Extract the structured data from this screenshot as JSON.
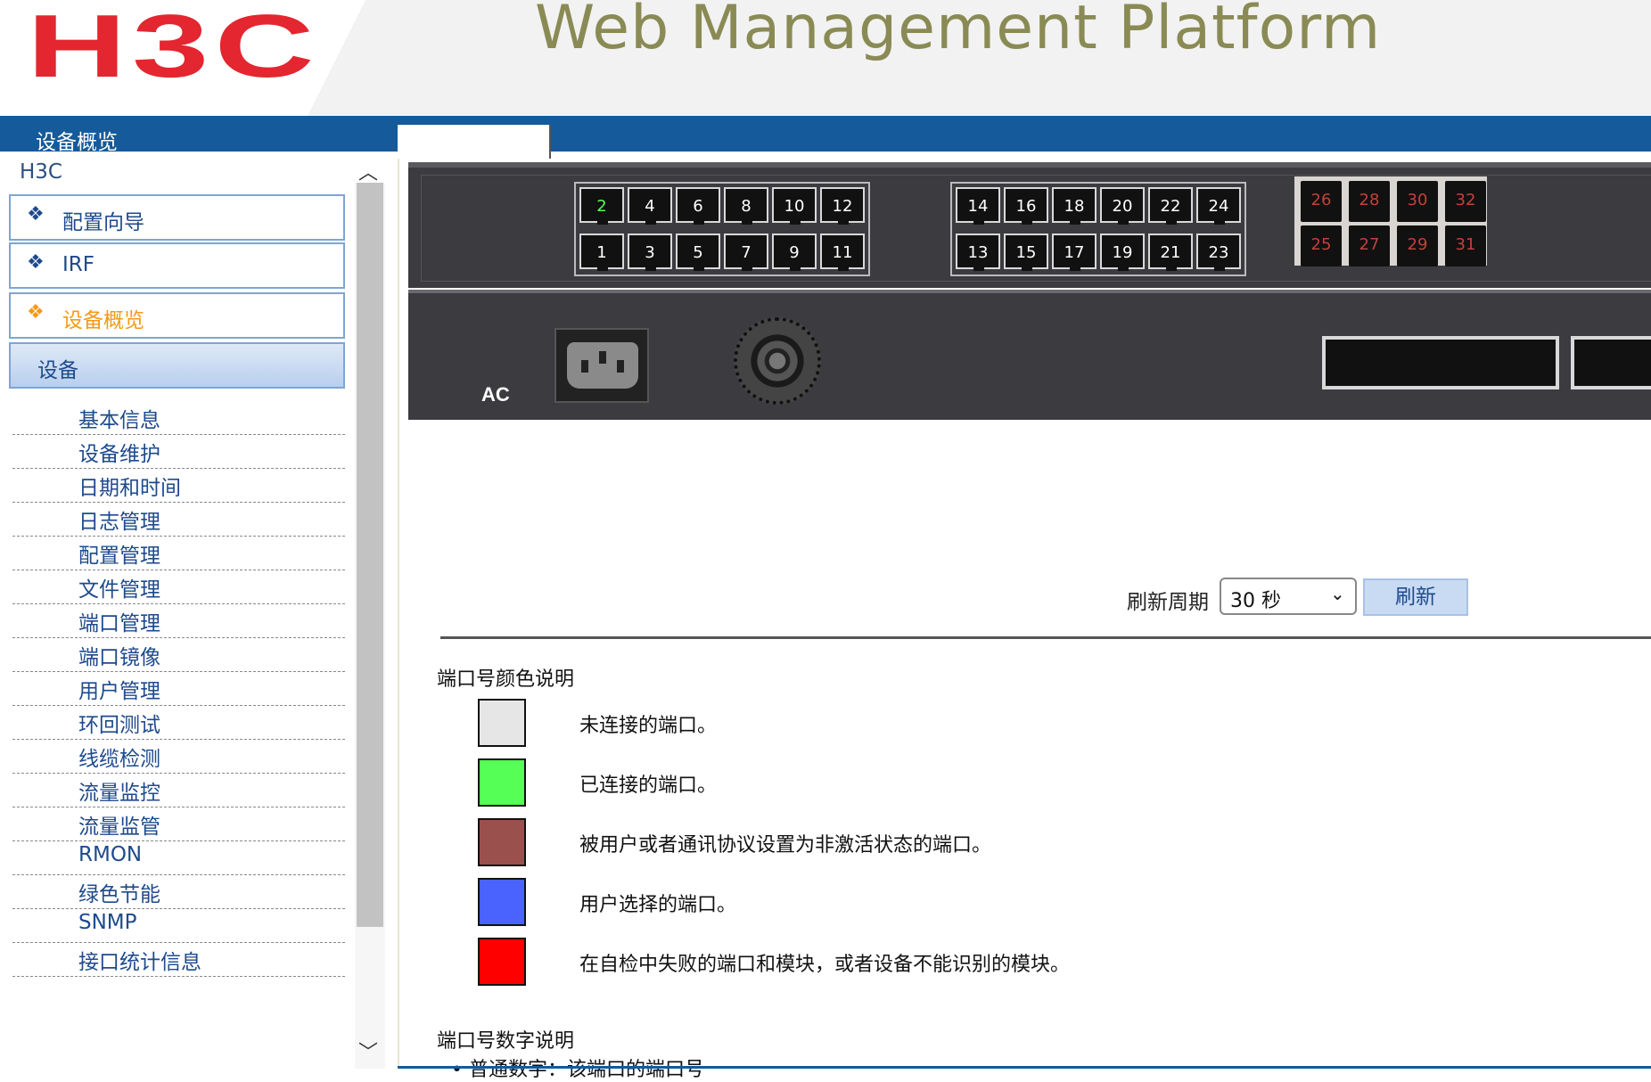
{
  "header": {
    "logo": "H3C",
    "title": "Web Management Platform",
    "breadcrumb": "设备概览"
  },
  "colors": {
    "brand_red": "#e3262f",
    "header_blue": "#155a9a",
    "menu_blue": "#1e4a8c",
    "active_orange": "#f49a16"
  },
  "sidebar": {
    "root": "H3C",
    "menus": [
      {
        "label": "配置向导",
        "icon": "diamond-icon"
      },
      {
        "label": "IRF",
        "icon": "diamond-icon"
      },
      {
        "label": "设备概览",
        "icon": "diamond-icon",
        "active": true
      }
    ],
    "group": "设备",
    "items": [
      "基本信息",
      "设备维护",
      "日期和时间",
      "日志管理",
      "配置管理",
      "文件管理",
      "端口管理",
      "端口镜像",
      "用户管理",
      "环回测试",
      "线缆检测",
      "流量监控",
      "流量监管",
      "RMON",
      "绿色节能",
      "SNMP",
      "接口统计信息"
    ]
  },
  "device": {
    "bank1_top": [
      "2",
      "4",
      "6",
      "8",
      "10",
      "12"
    ],
    "bank1_bottom": [
      "1",
      "3",
      "5",
      "7",
      "9",
      "11"
    ],
    "bank2_top": [
      "14",
      "16",
      "18",
      "20",
      "22",
      "24"
    ],
    "bank2_bottom": [
      "13",
      "15",
      "17",
      "19",
      "21",
      "23"
    ],
    "sfp_top": [
      "26",
      "28",
      "30",
      "32"
    ],
    "sfp_bottom": [
      "25",
      "27",
      "29",
      "31"
    ],
    "connected_ports": [
      "2"
    ],
    "power_label": "AC"
  },
  "refresh": {
    "label": "刷新周期",
    "selected": "30 秒",
    "button": "刷新"
  },
  "legend": {
    "title": "端口号颜色说明",
    "items": [
      {
        "color": "#e6e6e6",
        "text": "未连接的端口。"
      },
      {
        "color": "#55ff55",
        "text": "已连接的端口。"
      },
      {
        "color": "#9a504c",
        "text": "被用户或者通讯协议设置为非激活状态的端口。"
      },
      {
        "color": "#4a63ff",
        "text": "用户选择的端口。"
      },
      {
        "color": "#ff0000",
        "text": "在自检中失败的端口和模块，或者设备不能识别的模块。"
      }
    ],
    "digits_title": "端口号数字说明",
    "digits_line": "• 普通数字：该端口的端口号"
  }
}
